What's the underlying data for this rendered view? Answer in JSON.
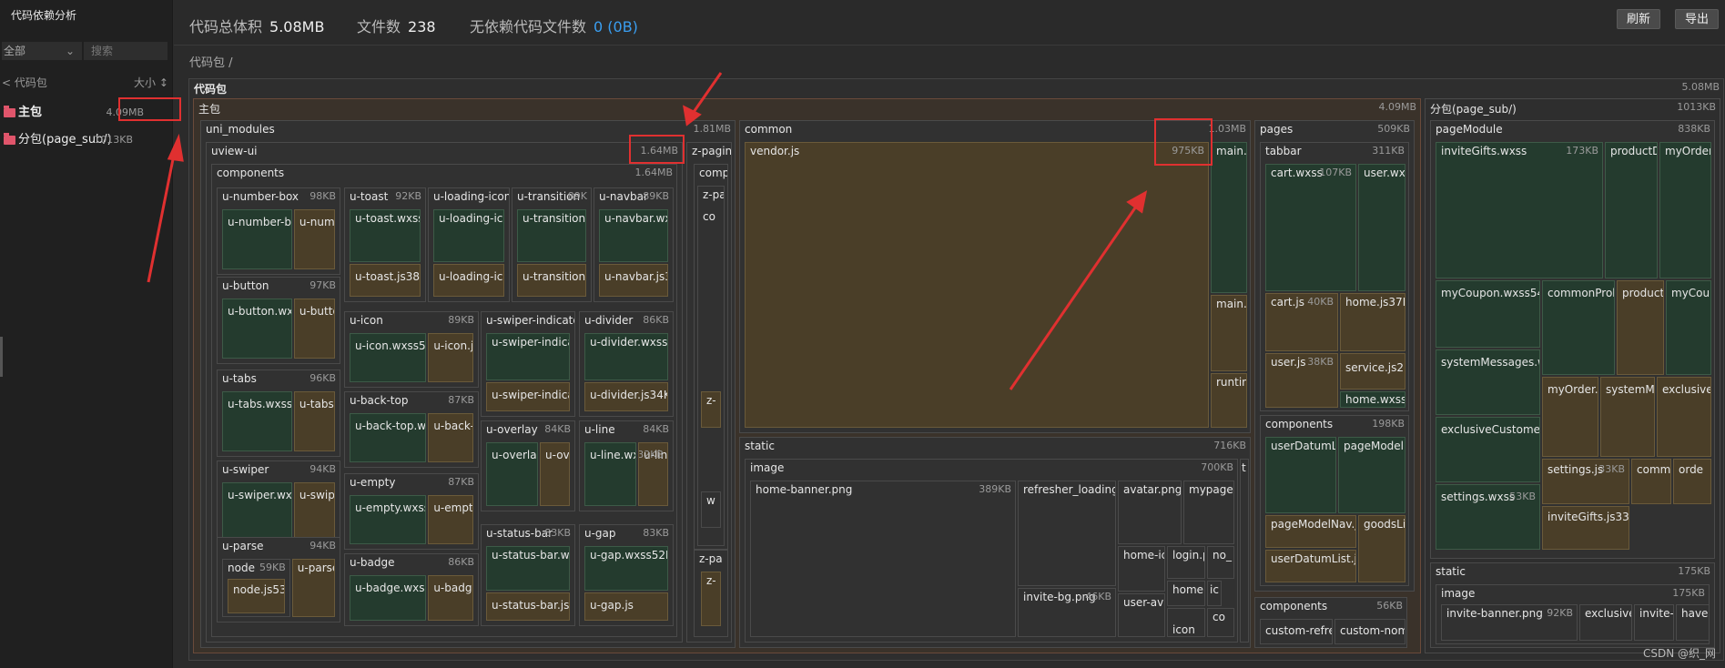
{
  "app": {
    "title": "代码依赖分析"
  },
  "sidebar": {
    "filter_value": "全部",
    "search_placeholder": "搜索",
    "back_label": "< 代码包",
    "sort_label": "大小 ↕",
    "packages": [
      {
        "name": "主包",
        "size": "4.09MB"
      },
      {
        "name": "分包(page_sub/)",
        "size": "1013KB"
      }
    ]
  },
  "header": {
    "total_label": "代码总体积",
    "total_value": "5.08MB",
    "files_label": "文件数",
    "files_value": "238",
    "nodep_label": "无依赖代码文件数",
    "nodep_value": "0 (0B)",
    "refresh_label": "刷新",
    "export_label": "导出"
  },
  "breadcrumb": "代码包 /",
  "treemap": {
    "root": {
      "name": "代码包",
      "size": "5.08MB"
    },
    "main": {
      "name": "主包",
      "size": "4.09MB"
    },
    "uni_modules": {
      "name": "uni_modules",
      "size": "1.81MB"
    },
    "uview": {
      "name": "uview-ui",
      "size": "1.64MB"
    },
    "zpaging": {
      "name": "z-paging",
      "size": ""
    },
    "components": {
      "name": "components",
      "size": "1.64MB"
    },
    "u_items": [
      {
        "name": "u-number-box",
        "size": "98KB",
        "a": "u-number-b",
        "b": "u-number"
      },
      {
        "name": "u-button",
        "size": "97KB",
        "a": "u-button.wxs",
        "b": "u-button"
      },
      {
        "name": "u-tabs",
        "size": "96KB",
        "a": "u-tabs.wxss5",
        "b": "u-tabs.js"
      },
      {
        "name": "u-swiper",
        "size": "94KB",
        "a": "u-swiper.wxs",
        "b": "u-swiper"
      },
      {
        "name": "u-parse",
        "size": "94KB",
        "a": "node",
        "a_size": "59KB",
        "a2": "node.js53K",
        "b": "u-parse"
      },
      {
        "name": "u-toast",
        "size": "92KB",
        "a": "u-toast.wxss5",
        "b": "u-toast.js38KI"
      },
      {
        "name": "u-loading-icon",
        "size": "",
        "a": "u-loading-ico",
        "b": "u-loading-ico"
      },
      {
        "name": "u-transition",
        "size": "89K",
        "a": "u-transition.w",
        "b": "u-transition.j"
      },
      {
        "name": "u-navbar",
        "size": "89KB",
        "a": "u-navbar.wxs",
        "b": "u-navbar.js35"
      },
      {
        "name": "u-icon",
        "size": "89KB",
        "a": "u-icon.wxss54",
        "b": "u-icon.js"
      },
      {
        "name": "u-back-top",
        "size": "87KB",
        "a": "u-back-top.w",
        "b": "u-back-t"
      },
      {
        "name": "u-empty",
        "size": "87KB",
        "a": "u-empty.wxss",
        "b": "u-empty"
      },
      {
        "name": "u-badge",
        "size": "86KB",
        "a": "u-badge.wxss",
        "b": "u-badge"
      },
      {
        "name": "u-swiper-indicator",
        "size": "",
        "a": "u-swiper-indicat",
        "b": "u-swiper-indicat"
      },
      {
        "name": "u-divider",
        "size": "86KB",
        "a": "u-divider.wxss53",
        "b": "u-divider.js34KB"
      },
      {
        "name": "u-overlay",
        "size": "84KB",
        "a": "u-overlay.wxss52",
        "b": "u-overlay.js32KB"
      },
      {
        "name": "u-line",
        "size": "84KB",
        "a": "u-line.wxss52KB",
        "b": "u-line.js",
        "b_size": "32KB"
      },
      {
        "name": "u-status-bar",
        "size": "83KB",
        "a": "u-status-bar.wxs",
        "b": "u-status-bar.js31"
      },
      {
        "name": "u-gap",
        "size": "83KB",
        "a": "u-gap.wxss52KB",
        "b": "u-gap.js",
        "b_size": "31KB"
      }
    ],
    "common": {
      "name": "common",
      "size": "1.03MB",
      "vendor": "vendor.js",
      "vendor_size": "975KB",
      "main_w": "main.w",
      "main_j": "main.j",
      "runtime": "runtim"
    },
    "static": {
      "name": "static",
      "size": "716KB",
      "image": "image",
      "image_size": "700KB",
      "t": "t",
      "files": [
        {
          "name": "home-banner.png",
          "size": "389KB"
        },
        {
          "name": "refresher_loading.g"
        },
        {
          "name": "avatar.png4"
        },
        {
          "name": "mypage-"
        },
        {
          "name": "home-ic"
        },
        {
          "name": "login.p"
        },
        {
          "name": "no_"
        },
        {
          "name": "invite-bg.png",
          "size": "46KB"
        },
        {
          "name": "user-ava"
        },
        {
          "name": "home"
        },
        {
          "name": "ic"
        },
        {
          "name": "co"
        },
        {
          "name": "icon"
        }
      ]
    },
    "pages": {
      "name": "pages",
      "size": "509KB",
      "tabbar": "tabbar",
      "tabbar_size": "311KB",
      "cart_wxss": "cart.wxss",
      "cart_wxss_size": "107KB",
      "user_wxss": "user.wxss",
      "cart_js": "cart.js",
      "cart_js_size": "40KB",
      "home_js": "home.js37KB",
      "user_js": "user.js",
      "user_js_size": "38KB",
      "service_js": "service.js21K",
      "home_wxss": "home.wxss13",
      "comp": "components",
      "comp_size": "198KB",
      "udl": "userDatumLis",
      "pmn": "pageModelN",
      "pmnjs": "pageModelNav.js3",
      "goods": "goodsLi",
      "udljs": "userDatumList.js31"
    },
    "components2": {
      "name": "components",
      "size": "56KB",
      "a": "custom-refres",
      "b": "custom-nome"
    },
    "sub": {
      "name": "分包(page_sub/)",
      "size": "1013KB",
      "pm": "pageModule",
      "pm_size": "838KB",
      "invite_wxss": "inviteGifts.wxss",
      "invite_wxss_size": "173KB",
      "productD": "productD",
      "myOrder": "myOrder.",
      "myCoupon": "myCoupon.wxss54KB",
      "commonProb": "commonProb",
      "productD2": "productD",
      "myCoup": "myCoup",
      "sysmsg": "systemMessages.wxs",
      "myOrderjs": "myOrder.js",
      "systemMe": "systemMe",
      "exclusiveC": "exclusiveC",
      "exclusive": "exclusiveCustomers.w",
      "settings_js": "settings.js",
      "settings_js_size": "33KB",
      "commo": "commo",
      "orde": "orde",
      "settings_wxss": "settings.wxss",
      "settings_wxss_size": "53KB",
      "invite_js": "inviteGifts.js33KB",
      "static": "static",
      "static_size": "175KB",
      "image": "image",
      "image_size": "175KB",
      "invite_banner": "invite-banner.png",
      "invite_banner_size": "92KB",
      "exclusive2": "exclusive",
      "invite_p": "invite-p",
      "have": "have-"
    }
  },
  "watermark": "CSDN @织_网"
}
